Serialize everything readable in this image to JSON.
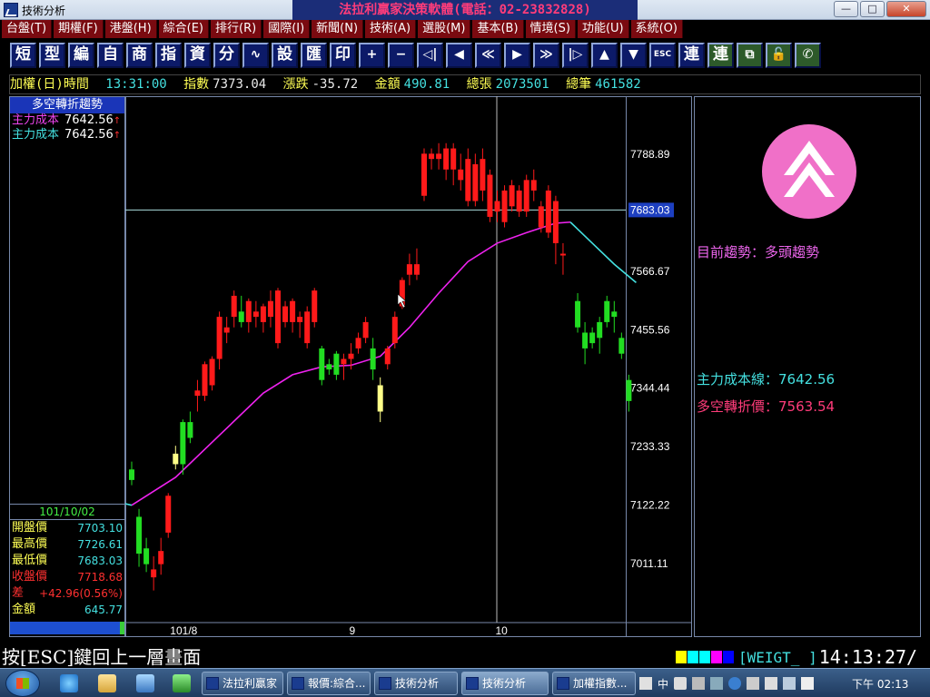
{
  "window": {
    "title": "技術分析",
    "banner": "法拉利贏家決策軟體(電話：02-23832828)",
    "buttons": {
      "minimize": "—",
      "maximize": "□",
      "close": "✕"
    }
  },
  "menu": [
    "台盤(T)",
    "期權(F)",
    "港盤(H)",
    "綜合(E)",
    "排行(R)",
    "國際(I)",
    "新聞(N)",
    "技術(A)",
    "選股(M)",
    "基本(B)",
    "情境(S)",
    "功能(U)",
    "系統(O)"
  ],
  "toolbar": [
    "短",
    "型",
    "編",
    "自",
    "商",
    "指",
    "資",
    "分",
    "∿",
    "設",
    "匯",
    "印",
    "+",
    "−",
    "◁|",
    "◀",
    "≪",
    "▶",
    "≫",
    "|▷",
    "▲",
    "▼",
    "ESC",
    "連",
    "連",
    "⧉",
    "🔓",
    "✆"
  ],
  "infoline": {
    "name": "加權(日)",
    "time_label": "時間",
    "time": "13:31:00",
    "index_label": "指數",
    "index": "7373.04",
    "change_label": "漲跌",
    "change": "-35.72",
    "amount_label": "金額",
    "amount": "490.81",
    "vol_label": "總張",
    "vol": "2073501",
    "trades_label": "總筆",
    "trades": "461582"
  },
  "left": {
    "header": "多空轉折趨勢",
    "cost_rows": [
      {
        "label": "主力成本",
        "value": "7642.56",
        "arrow": "↑"
      },
      {
        "label": "主力成本",
        "value": "7642.56",
        "arrow": "↑"
      }
    ],
    "ohlc": {
      "date": "101/10/02",
      "rows": [
        {
          "label": "開盤價",
          "value": "7703.10",
          "lc": "#ffff55",
          "vc": "#44e0e0"
        },
        {
          "label": "最高價",
          "value": "7726.61",
          "lc": "#ffff55",
          "vc": "#44e0e0"
        },
        {
          "label": "最低價",
          "value": "7683.03",
          "lc": "#ffff55",
          "vc": "#44e0e0"
        },
        {
          "label": "收盤價",
          "value": "7718.68",
          "lc": "#ff3030",
          "vc": "#ff3030"
        },
        {
          "label": "差",
          "value": "+42.96(0.56%)",
          "lc": "#ff3030",
          "vc": "#ff3030"
        },
        {
          "label": "金額",
          "value": "645.77",
          "lc": "#ffff55",
          "vc": "#44e0e0"
        }
      ]
    }
  },
  "chart": {
    "yticks": [
      "7788.89",
      "7683.03",
      "7566.67",
      "7455.56",
      "7344.44",
      "7233.33",
      "7122.22",
      "7011.11"
    ],
    "xticks": [
      "101/8",
      "9",
      "10"
    ],
    "crosshair_value": "7683.03",
    "colors": {
      "up": "#ff1a1a",
      "down": "#22dd22",
      "doji": "#ffff88",
      "ma_up": "#ee22ee",
      "ma_down": "#44e0e0",
      "grid": "#7788aa"
    },
    "candles": [
      [
        7190,
        7170,
        7205,
        7160
      ],
      [
        7100,
        7030,
        7115,
        7005
      ],
      [
        7040,
        7010,
        7060,
        6995
      ],
      [
        6985,
        7000,
        7025,
        6960
      ],
      [
        7010,
        7035,
        7060,
        6990
      ],
      [
        7070,
        7140,
        7145,
        7060
      ],
      [
        7200,
        7220,
        7235,
        7190
      ],
      [
        7280,
        7200,
        7285,
        7180
      ],
      [
        7280,
        7250,
        7300,
        7240
      ],
      [
        7330,
        7340,
        7360,
        7300
      ],
      [
        7330,
        7390,
        7395,
        7320
      ],
      [
        7350,
        7400,
        7405,
        7340
      ],
      [
        7400,
        7480,
        7490,
        7380
      ],
      [
        7450,
        7460,
        7480,
        7430
      ],
      [
        7480,
        7520,
        7530,
        7460
      ],
      [
        7490,
        7470,
        7520,
        7460
      ],
      [
        7470,
        7510,
        7515,
        7450
      ],
      [
        7480,
        7490,
        7510,
        7460
      ],
      [
        7470,
        7500,
        7505,
        7450
      ],
      [
        7480,
        7510,
        7530,
        7460
      ],
      [
        7430,
        7530,
        7535,
        7420
      ],
      [
        7470,
        7500,
        7510,
        7460
      ],
      [
        7470,
        7510,
        7515,
        7450
      ],
      [
        7470,
        7480,
        7490,
        7440
      ],
      [
        7430,
        7490,
        7500,
        7420
      ],
      [
        7470,
        7530,
        7535,
        7460
      ],
      [
        7420,
        7360,
        7425,
        7350
      ],
      [
        7390,
        7380,
        7400,
        7370
      ],
      [
        7410,
        7370,
        7415,
        7360
      ],
      [
        7390,
        7400,
        7410,
        7360
      ],
      [
        7400,
        7410,
        7430,
        7380
      ],
      [
        7420,
        7440,
        7450,
        7410
      ],
      [
        7440,
        7470,
        7480,
        7430
      ],
      [
        7420,
        7380,
        7440,
        7360
      ],
      [
        7350,
        7300,
        7365,
        7280
      ],
      [
        7390,
        7420,
        7425,
        7380
      ],
      [
        7430,
        7480,
        7490,
        7420
      ],
      [
        7500,
        7550,
        7555,
        7495
      ],
      [
        7560,
        7580,
        7600,
        7540
      ],
      [
        7560,
        7580,
        7610,
        7550
      ],
      [
        7710,
        7790,
        7800,
        7700
      ],
      [
        7780,
        7790,
        7800,
        7760
      ],
      [
        7780,
        7790,
        7810,
        7760
      ],
      [
        7760,
        7800,
        7810,
        7740
      ],
      [
        7760,
        7800,
        7810,
        7730
      ],
      [
        7740,
        7760,
        7790,
        7720
      ],
      [
        7700,
        7780,
        7800,
        7690
      ],
      [
        7700,
        7770,
        7790,
        7690
      ],
      [
        7720,
        7780,
        7800,
        7700
      ],
      [
        7670,
        7750,
        7760,
        7660
      ],
      [
        7680,
        7700,
        7720,
        7660
      ],
      [
        7660,
        7720,
        7730,
        7650
      ],
      [
        7690,
        7730,
        7740,
        7680
      ],
      [
        7680,
        7720,
        7730,
        7670
      ],
      [
        7680,
        7740,
        7750,
        7670
      ],
      [
        7720,
        7740,
        7760,
        7700
      ],
      [
        7650,
        7690,
        7700,
        7640
      ],
      [
        7640,
        7720,
        7730,
        7630
      ],
      [
        7620,
        7700,
        7710,
        7580
      ],
      [
        7600,
        7600,
        7620,
        7560
      ],
      null,
      [
        7510,
        7460,
        7525,
        7450
      ],
      [
        7450,
        7420,
        7470,
        7390
      ],
      [
        7430,
        7450,
        7460,
        7420
      ],
      [
        7470,
        7440,
        7480,
        7410
      ],
      [
        7470,
        7510,
        7520,
        7460
      ],
      [
        7480,
        7490,
        7510,
        7450
      ],
      [
        7440,
        7410,
        7450,
        7400
      ],
      [
        7360,
        7320,
        7370,
        7300
      ]
    ],
    "ma_up": [
      [
        0,
        7122
      ],
      [
        6,
        7175
      ],
      [
        12,
        7255
      ],
      [
        18,
        7335
      ],
      [
        22,
        7370
      ],
      [
        26,
        7385
      ],
      [
        30,
        7388
      ],
      [
        34,
        7405
      ],
      [
        38,
        7460
      ],
      [
        42,
        7525
      ],
      [
        46,
        7585
      ],
      [
        50,
        7620
      ],
      [
        54,
        7640
      ],
      [
        58,
        7658
      ],
      [
        60,
        7660
      ]
    ],
    "ma_down": [
      [
        -14,
        7215
      ],
      [
        -10,
        7160
      ],
      [
        -6,
        7122
      ],
      [
        60,
        7660
      ],
      [
        63,
        7620
      ],
      [
        66,
        7580
      ],
      [
        69,
        7545
      ]
    ],
    "cursor_x_index": 50
  },
  "right": {
    "trend_label": "目前趨勢：",
    "trend_value": "多頭趨勢",
    "cost_line_label": "主力成本線：",
    "cost_line_value": "7642.56",
    "turn_label": "多空轉折價：",
    "turn_value": "7563.54"
  },
  "status": {
    "hint": "按[ESC]鍵回上一層畫面",
    "weigt": "[WEIGT_ ]",
    "clock": "14:13:27/",
    "swatches": [
      "#ffff00",
      "#00ffff",
      "#00ffff",
      "#ff00ff",
      "#0000ff"
    ]
  },
  "taskbar": {
    "tasks": [
      {
        "label": "法拉利贏家",
        "left": 222,
        "width": 90
      },
      {
        "label": "報價:綜合...",
        "left": 316,
        "width": 92
      },
      {
        "label": "技術分析",
        "left": 412,
        "width": 92
      },
      {
        "label": "技術分析",
        "left": 508,
        "width": 96
      },
      {
        "label": "加權指數...",
        "left": 608,
        "width": 92
      }
    ],
    "tray_ime": "中",
    "clock": "下午 02:13"
  }
}
